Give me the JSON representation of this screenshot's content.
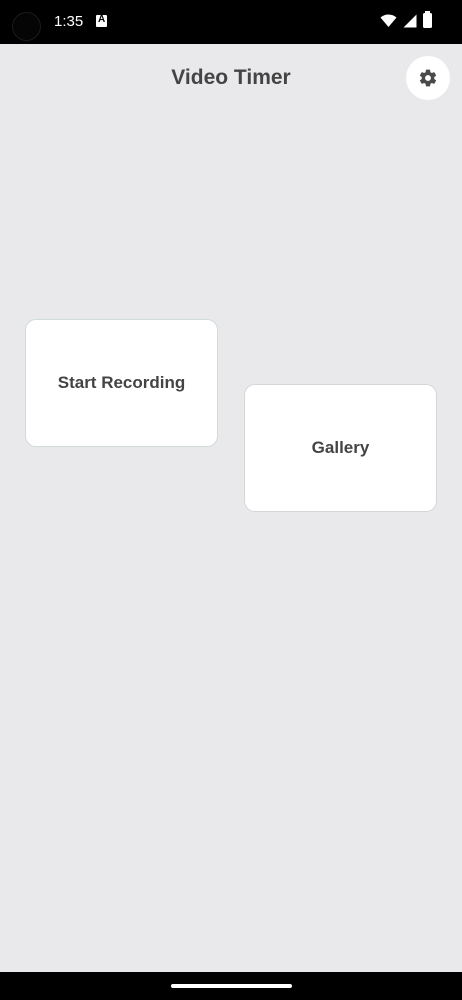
{
  "status_bar": {
    "time": "1:35",
    "notification_icon": "text-app-icon",
    "icons": [
      "wifi-icon",
      "cellular-signal-icon",
      "battery-icon"
    ]
  },
  "app_bar": {
    "title": "Video Timer",
    "settings_icon": "gear-icon"
  },
  "main": {
    "start_recording_label": "Start Recording",
    "gallery_label": "Gallery"
  },
  "colors": {
    "background": "#e9e8eb",
    "card": "#ffffff",
    "text": "#444444",
    "status_bar": "#000000"
  }
}
